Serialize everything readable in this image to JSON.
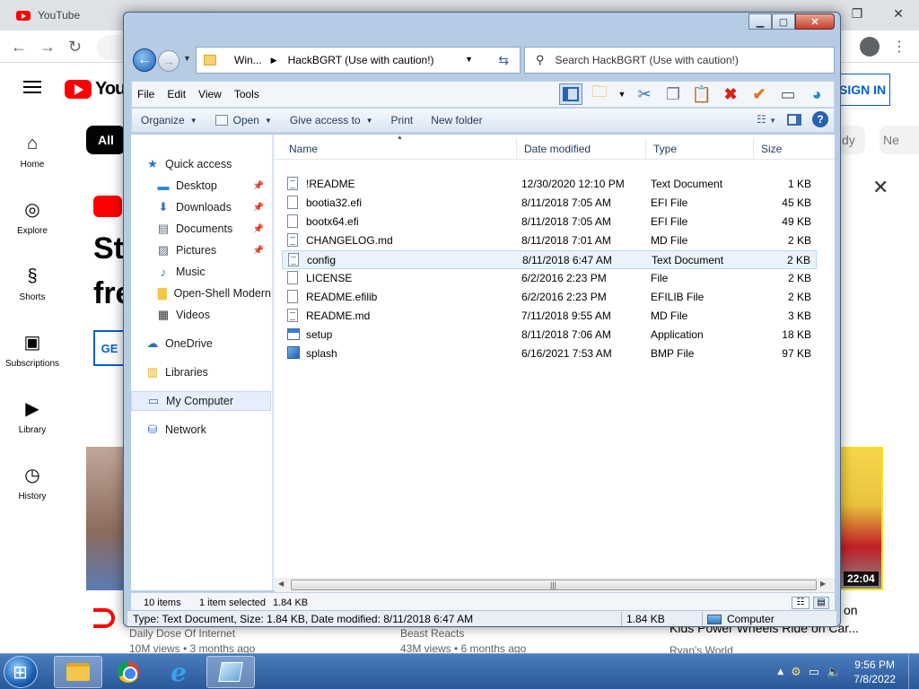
{
  "background": {
    "chrome": {
      "tab_title": "YouTube"
    },
    "youtube": {
      "logo_text": "YouTube",
      "sign_in_label": "SIGN IN",
      "chip_all": "All",
      "chip_partial_1": "dy",
      "chip_partial_2": "Ne",
      "side_items": [
        {
          "label": "Home",
          "icon": "home-icon"
        },
        {
          "label": "Explore",
          "icon": "compass-icon"
        },
        {
          "label": "Shorts",
          "icon": "shorts-icon"
        },
        {
          "label": "Subscriptions",
          "icon": "subscriptions-icon"
        },
        {
          "label": "Library",
          "icon": "library-icon"
        },
        {
          "label": "History",
          "icon": "history-icon"
        }
      ],
      "banner_title_1": "St",
      "banner_title_2": "fre",
      "banner_button": "GE",
      "video_duration": "22:04",
      "videos": [
        {
          "channel": "Daily Dose Of Internet",
          "meta": "10M views • 3 months ago"
        },
        {
          "channel": "Beast Reacts",
          "meta": "43M views • 6 months ago"
        },
        {
          "title_partial": "Kids Power Wheels Ride on Car...",
          "title_partial_top": "on",
          "channel": "Ryan's World"
        }
      ]
    }
  },
  "explorer": {
    "address": {
      "segments": [
        "Win...",
        "HackBGRT (Use with caution!)"
      ]
    },
    "search_placeholder": "Search HackBGRT (Use with caution!)",
    "menu": [
      "File",
      "Edit",
      "View",
      "Tools"
    ],
    "commands": {
      "organize": "Organize",
      "open": "Open",
      "give_access": "Give access to",
      "print": "Print",
      "new_folder": "New folder"
    },
    "nav_pane": [
      {
        "label": "Quick access",
        "icon": "star-icon",
        "pinned": false
      },
      {
        "label": "Desktop",
        "icon": "desktop-icon",
        "pinned": true
      },
      {
        "label": "Downloads",
        "icon": "download-icon",
        "pinned": true
      },
      {
        "label": "Documents",
        "icon": "documents-icon",
        "pinned": true
      },
      {
        "label": "Pictures",
        "icon": "pictures-icon",
        "pinned": true
      },
      {
        "label": "Music",
        "icon": "music-icon",
        "pinned": false
      },
      {
        "label": "Open-Shell Modern",
        "icon": "folder-icon",
        "pinned": false
      },
      {
        "label": "Videos",
        "icon": "videos-icon",
        "pinned": false
      },
      {
        "label": "OneDrive",
        "icon": "cloud-icon",
        "pinned": false
      },
      {
        "label": "Libraries",
        "icon": "libraries-icon",
        "pinned": false
      },
      {
        "label": "My Computer",
        "icon": "computer-icon",
        "pinned": false,
        "selected": true
      },
      {
        "label": "Network",
        "icon": "network-icon",
        "pinned": false
      }
    ],
    "columns": [
      "Name",
      "Date modified",
      "Type",
      "Size"
    ],
    "files": [
      {
        "name": "!README",
        "date": "12/30/2020 12:10 PM",
        "type": "Text Document",
        "size": "1 KB",
        "icon": "text-file-icon"
      },
      {
        "name": "bootia32.efi",
        "date": "8/11/2018 7:05 AM",
        "type": "EFI File",
        "size": "45 KB",
        "icon": "file-icon"
      },
      {
        "name": "bootx64.efi",
        "date": "8/11/2018 7:05 AM",
        "type": "EFI File",
        "size": "49 KB",
        "icon": "file-icon"
      },
      {
        "name": "CHANGELOG.md",
        "date": "8/11/2018 7:01 AM",
        "type": "MD File",
        "size": "2 KB",
        "icon": "text-file-icon"
      },
      {
        "name": "config",
        "date": "8/11/2018 6:47 AM",
        "type": "Text Document",
        "size": "2 KB",
        "icon": "text-file-icon",
        "selected": true
      },
      {
        "name": "LICENSE",
        "date": "6/2/2016 2:23 PM",
        "type": "File",
        "size": "2 KB",
        "icon": "file-icon"
      },
      {
        "name": "README.efilib",
        "date": "6/2/2016 2:23 PM",
        "type": "EFILIB File",
        "size": "2 KB",
        "icon": "file-icon"
      },
      {
        "name": "README.md",
        "date": "7/11/2018 9:55 AM",
        "type": "MD File",
        "size": "3 KB",
        "icon": "text-file-icon"
      },
      {
        "name": "setup",
        "date": "8/11/2018 7:06 AM",
        "type": "Application",
        "size": "18 KB",
        "icon": "application-icon"
      },
      {
        "name": "splash",
        "date": "6/16/2021 7:53 AM",
        "type": "BMP File",
        "size": "97 KB",
        "icon": "bitmap-icon"
      }
    ],
    "info": {
      "item_count": "10 items",
      "selection": "1 item selected",
      "selection_size": "1.84 KB"
    },
    "status": {
      "details": "Type: Text Document, Size: 1.84 KB, Date modified: 8/11/2018 6:47 AM",
      "size": "1.84 KB",
      "location": "Computer"
    }
  },
  "taskbar": {
    "time": "9:56 PM",
    "date": "7/8/2022"
  }
}
